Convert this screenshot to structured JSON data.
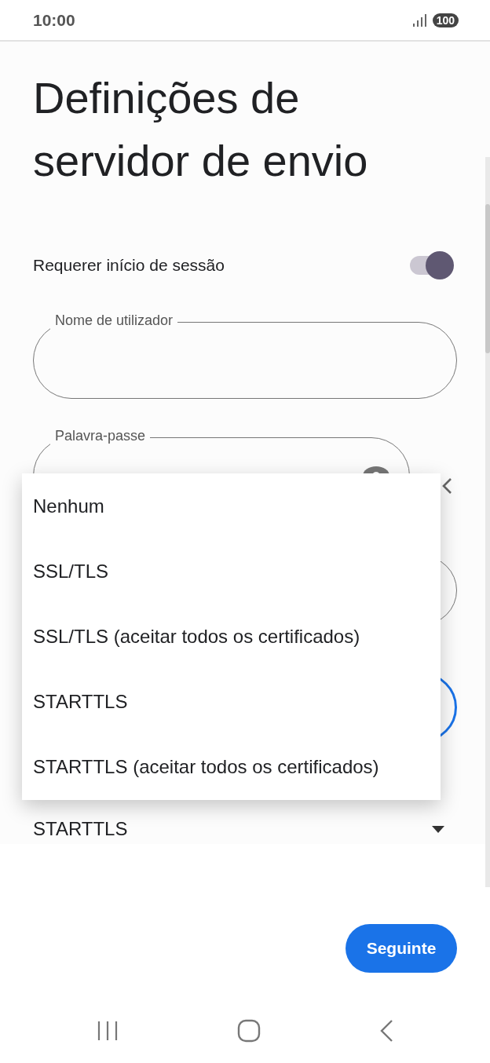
{
  "status_bar": {
    "time": "10:00",
    "battery": "100"
  },
  "title": "Definições de servidor de envio",
  "require_login": {
    "label": "Requerer início de sessão",
    "on": true
  },
  "fields": [
    {
      "kind": "text",
      "label": "Nome de utilizador",
      "focused": false
    },
    {
      "kind": "password",
      "label": "Palavra-passe",
      "focused": false
    },
    {
      "kind": "text",
      "focused": false
    },
    {
      "kind": "text",
      "focused": true
    }
  ],
  "security": {
    "value": "STARTTLS"
  },
  "menu": {
    "options": [
      {
        "label": "Nenhum"
      },
      {
        "label": "SSL/TLS"
      },
      {
        "label": "SSL/TLS (aceitar todos os certificados)"
      },
      {
        "label": "STARTTLS"
      },
      {
        "label": "STARTTLS (aceitar todos os certificados)"
      }
    ]
  },
  "next_button": "Seguinte"
}
